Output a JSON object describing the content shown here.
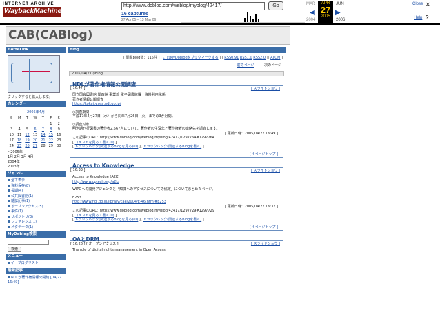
{
  "wayback": {
    "logo_top": "INTERNET ARCHIVE",
    "logo_main": "WaybackMachine",
    "url": "http://www.dobloq.com/weblog/myblog/42417/",
    "go": "Go",
    "captures": "16 captures",
    "range": "27 Apr 05 – 13 May 06",
    "months": {
      "prev": "MAR",
      "cur": "APR",
      "next": "JUN"
    },
    "day": "27",
    "years": {
      "prev": "2004",
      "cur": "2005",
      "next": "2006"
    },
    "close": "Close",
    "help": "Help",
    "close_glyph": "✕",
    "help_glyph": "?",
    "prev_arrow": "◀",
    "next_arrow": "▶"
  },
  "blog": {
    "title": "CAB(CABlog)"
  },
  "left": {
    "hottelink_header": "HotteLink",
    "map_caption": "クリックすると拡大します。",
    "calendar_header": "カレンダー",
    "calendar": {
      "title": "2005年4月",
      "days": [
        "S",
        "M",
        "T",
        "W",
        "T",
        "F",
        "S"
      ],
      "rows": [
        [
          "",
          "",
          "",
          "",
          "",
          "1",
          "2"
        ],
        [
          "3",
          "4",
          "5",
          "6",
          "7",
          "8",
          "9"
        ],
        [
          "10",
          "11",
          "12",
          "13",
          "14",
          "15",
          "16"
        ],
        [
          "17",
          "18",
          "19",
          "20",
          "21",
          "22",
          "23"
        ],
        [
          "24",
          "25",
          "26",
          "27",
          "28",
          "29",
          "30"
        ]
      ]
    },
    "months": [
      "~2005年",
      "1月  2月  3月  4月",
      "2004年",
      "2003年"
    ],
    "genre_header": "ジャンル",
    "genres": [
      "全て表示",
      "資料保存(8)",
      "長期(4)",
      "公共図書館(1)",
      "雑誌記事(1)",
      "オープンアクセス(5)",
      "事件(1)",
      "リポジトリ(3)",
      "レファレンス(1)",
      "メタデータ(1)"
    ],
    "search_header": "MyDoblog検索",
    "search_button": "検索",
    "menu_header": "メニュー",
    "menu_item": "イーブログリスト",
    "recent_header": "最新記事",
    "recent_item": "NDLが著作権情報公開館 [04/27 16:49]"
  },
  "main": {
    "header": "Blog",
    "toplinks": "[ 閲覧blog数：115件 ] [ ",
    "bookmark": "このMyDoblogをブックマークする",
    "rss1": "RSS0.91",
    "rss2": "RSS1.0",
    "rss3": "RSS2.0",
    "atom": "ATOM",
    "prev_page": "前のページ",
    "sep": "｜",
    "next_page": "次のページ",
    "date": "2005/04/27のBlog",
    "entries": [
      {
        "title": "NDLが著作権情報公開調査",
        "time": "[ 16:47 ]",
        "slideshow": "[ スライドショウ ]",
        "lines": [
          "国立国会図書館 関西館 事業部 電子図書館課　資料利用化係",
          "著作者情報公開調査",
          "https://kokaity.osa.ndl.go.jp/",
          "",
          "○調査期間",
          "平成17年4月27日（水）から同年7月26日（火）までの3か月間。",
          "",
          "○調査対象",
          "明治期刊行図書の著作者2,567人について、著作者の生没年と著作権者の連絡先を調査します。"
        ],
        "updated": "[ 更新日時：2005/04/27 16:49 ]",
        "url_label": "この記事のURL：",
        "url": "http://www.dobloq.com/weblog/myblog/42417/1297764#1297764",
        "comment": "コメントを見る・書く(0)",
        "tb1": "トラックバック(関連するBlogを見る)(0)",
        "tb2": "トラックバック(関連するBlogを書く)",
        "pagetop": "[ ↑ページトップ ]"
      },
      {
        "title": "Access to Knowledge",
        "time": "[ 16:33 ]",
        "slideshow": "[ スライドショウ ]",
        "lines": [
          "Access to Knowledge (A2K)",
          "http://www.cptech.org/a2k/",
          "",
          "WIPOへの開発アジェンダと「知識へのアクセスについての協定」についてまとめたページ。",
          "",
          "E253",
          "http://www.ndl.go.jp/library/cae/2004/E-46.html#E253"
        ],
        "updated": "[ 更新日時：2005/04/27 16:37 ]",
        "url_label": "この記事のURL：",
        "url": "http://www.dobloq.com/weblog/myblog/42417/1297729#1297729",
        "comment": "コメントを見る・書く(0)",
        "tb1": "トラックバック(関連するBlogを見る)(0)",
        "tb2": "トラックバック(関連するBlogを書く)",
        "pagetop": "[ ↑ページトップ ]"
      },
      {
        "title": "OAとDRM",
        "time": "[ 16:26 ] [ オープンアクセス ]",
        "slideshow": "[ スライドショウ ]",
        "first_line": "The role of digital rights management in Open Access"
      }
    ]
  }
}
